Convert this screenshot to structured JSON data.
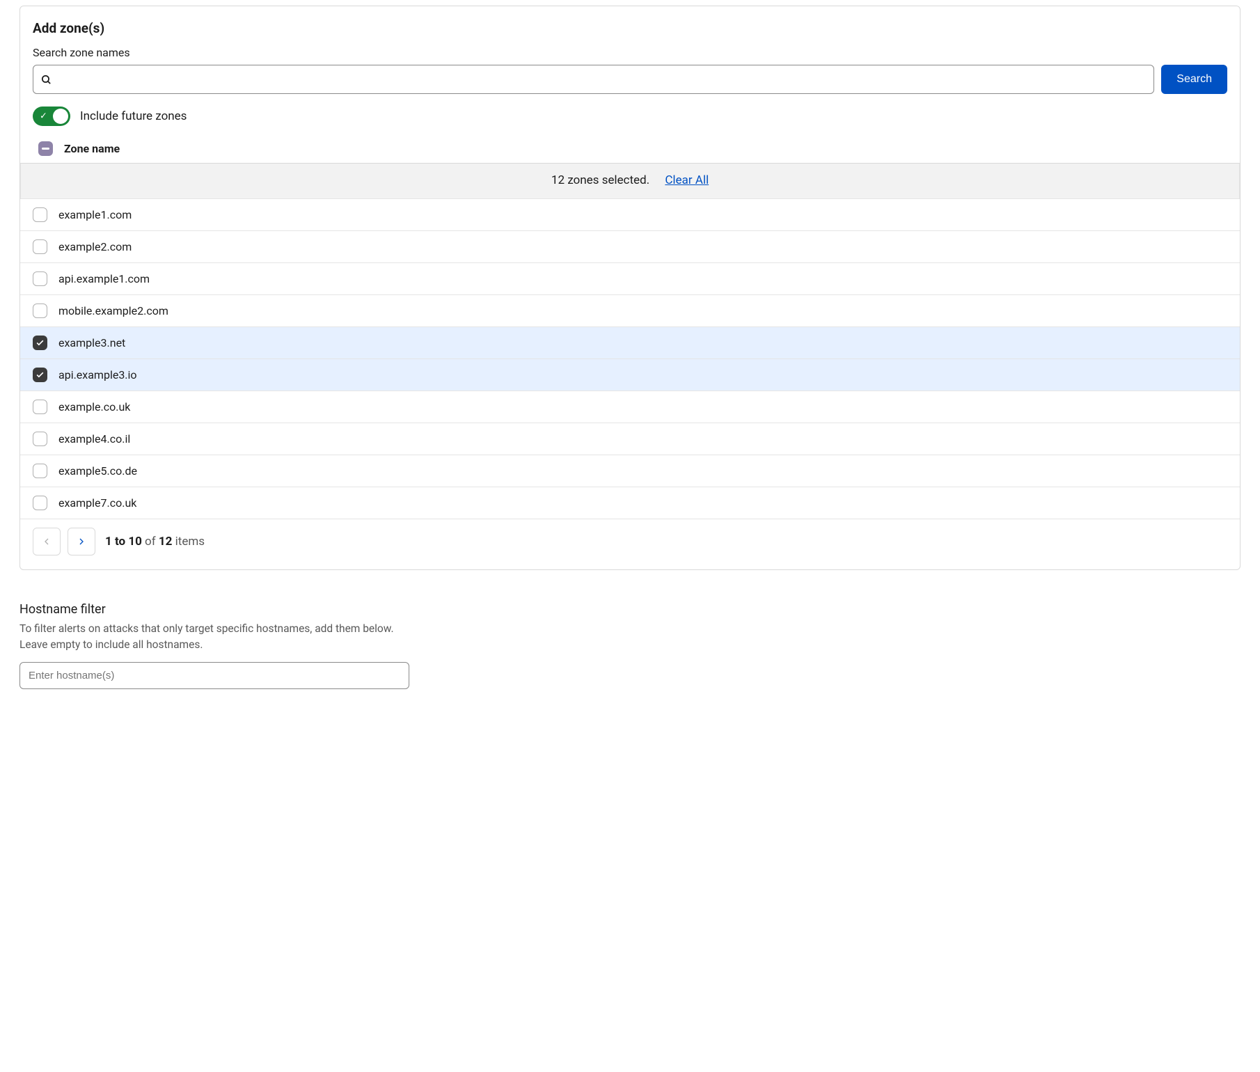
{
  "panel": {
    "title": "Add zone(s)",
    "search_label": "Search zone names",
    "search_placeholder": "",
    "search_button": "Search",
    "toggle_label": "Include future zones",
    "column_header": "Zone name"
  },
  "selection": {
    "text": "12 zones selected.",
    "clear_label": "Clear All"
  },
  "zones": [
    {
      "name": "example1.com",
      "checked": false
    },
    {
      "name": "example2.com",
      "checked": false
    },
    {
      "name": "api.example1.com",
      "checked": false
    },
    {
      "name": "mobile.example2.com",
      "checked": false
    },
    {
      "name": "example3.net",
      "checked": true
    },
    {
      "name": "api.example3.io",
      "checked": true
    },
    {
      "name": "example.co.uk",
      "checked": false
    },
    {
      "name": "example4.co.il",
      "checked": false
    },
    {
      "name": "example5.co.de",
      "checked": false
    },
    {
      "name": "example7.co.uk",
      "checked": false
    }
  ],
  "pagination": {
    "range": "1 to 10",
    "of": " of ",
    "total": "12",
    "suffix": " items"
  },
  "hostname": {
    "title": "Hostname filter",
    "description": "To filter alerts on attacks that only target specific hostnames, add them below. Leave empty to include all hostnames.",
    "placeholder": "Enter hostname(s)"
  }
}
